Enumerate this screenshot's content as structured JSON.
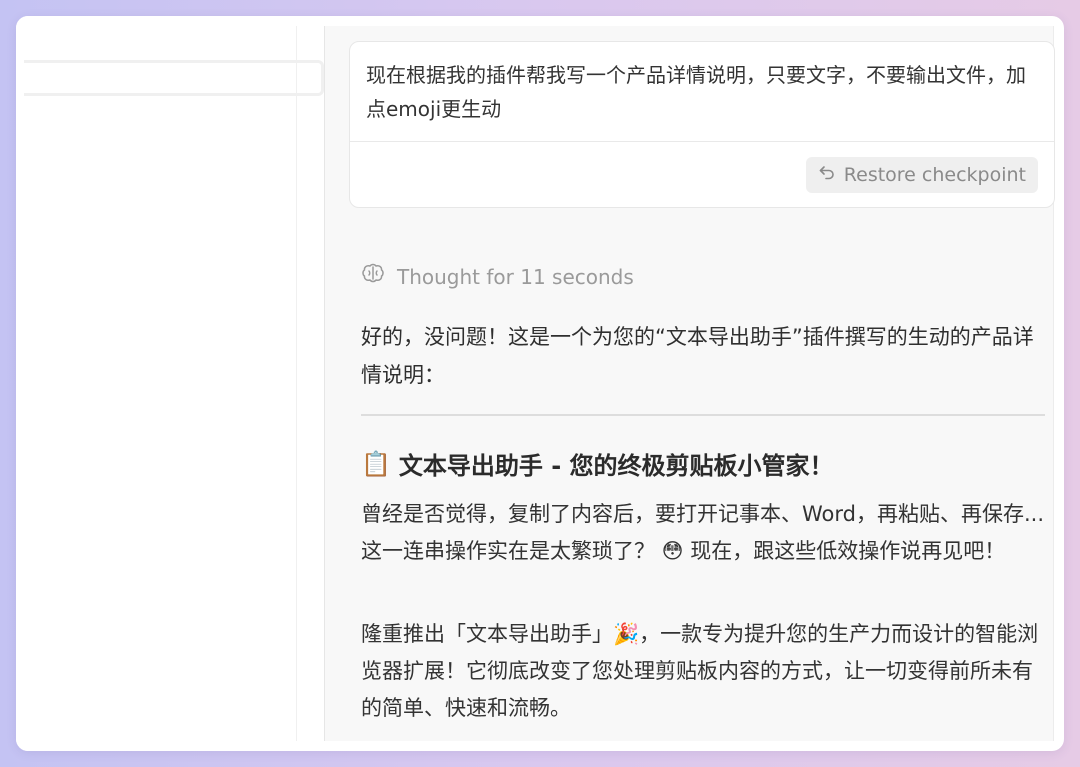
{
  "chat": {
    "user_message": "现在根据我的插件帮我写一个产品详情说明，只要文字，不要输出文件，加点emoji更生动",
    "restore_label": "Restore checkpoint",
    "thought_label": "Thought for 11 seconds",
    "reply_intro": "好的，没问题！这是一个为您的“文本导出助手”插件撰写的生动的产品详情说明：",
    "heading_emoji": "📋",
    "heading_text": "文本导出助手 - 您的终极剪贴板小管家！",
    "paragraph_1": "曾经是否觉得，复制了内容后，要打开记事本、Word，再粘贴、再保存...这一连串操作实在是太繁琐了？ 😳 现在，跟这些低效操作说再见吧！",
    "paragraph_2": "隆重推出「文本导出助手」🎉，一款专为提升您的生产力而设计的智能浏览器扩展！它彻底改变了您处理剪贴板内容的方式，让一切变得前所未有的简单、快速和流畅。"
  },
  "icons": {
    "restore": "undo-arrow-icon",
    "thought": "brain-icon"
  }
}
